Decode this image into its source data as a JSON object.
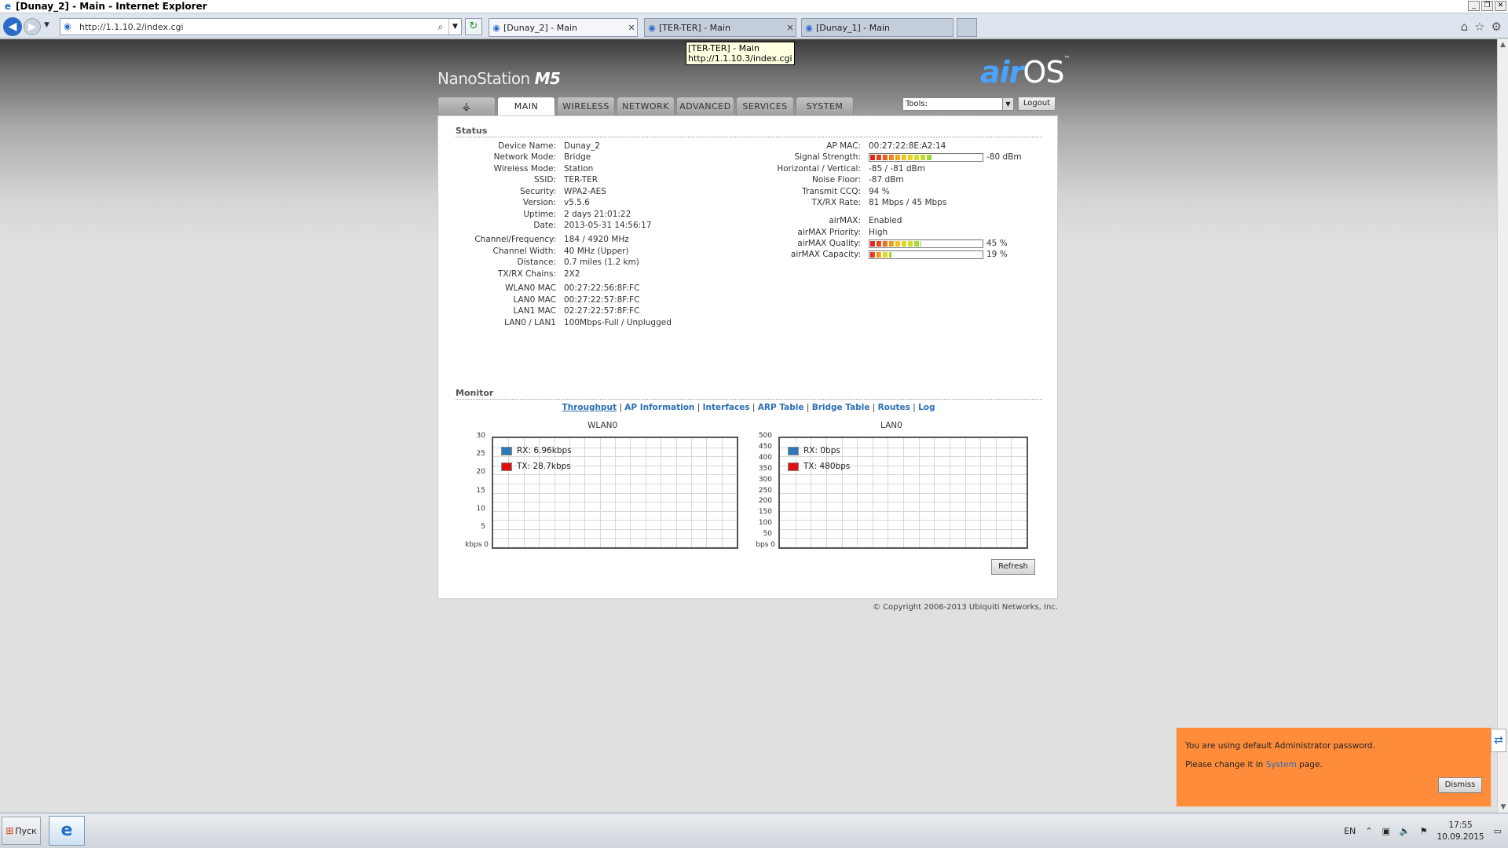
{
  "window": {
    "title": "[Dunay_2] - Main - Internet Explorer",
    "controls": [
      "_",
      "❐",
      "✕"
    ]
  },
  "browser": {
    "address": "http://1.1.10.2/index.cgi",
    "tabs": [
      {
        "label": "[Dunay_2] - Main",
        "active": true
      },
      {
        "label": "[TER-TER] - Main",
        "active": false
      },
      {
        "label": "[Dunay_1] - Main",
        "active": false
      }
    ],
    "tooltip": {
      "line1": "[TER-TER] - Main",
      "line2": "http://1.1.10.3/index.cgi"
    }
  },
  "device": {
    "product": "NanoStation",
    "model": "M5",
    "logo_air": "air",
    "logo_os": "OS",
    "logo_tm": "™"
  },
  "nav": {
    "tabs": [
      "MAIN",
      "WIRELESS",
      "NETWORK",
      "ADVANCED",
      "SERVICES",
      "SYSTEM"
    ],
    "active": "MAIN",
    "tools_label": "Tools:",
    "logout": "Logout"
  },
  "status": {
    "heading": "Status",
    "left": [
      {
        "k": "Device Name:",
        "v": "Dunay_2"
      },
      {
        "k": "Network Mode:",
        "v": "Bridge"
      },
      {
        "k": "Wireless Mode:",
        "v": "Station"
      },
      {
        "k": "SSID:",
        "v": "TER-TER"
      },
      {
        "k": "Security:",
        "v": "WPA2-AES"
      },
      {
        "k": "Version:",
        "v": "v5.5.6"
      },
      {
        "k": "Uptime:",
        "v": "2 days 21:01:22"
      },
      {
        "k": "Date:",
        "v": "2013-05-31 14:56:17"
      },
      {
        "k": "Channel/Frequency:",
        "v": "184 / 4920 MHz"
      },
      {
        "k": "Channel Width:",
        "v": "40 MHz (Upper)"
      },
      {
        "k": "Distance:",
        "v": "0.7 miles (1.2 km)"
      },
      {
        "k": "TX/RX Chains:",
        "v": "2X2"
      },
      {
        "k": "WLAN0 MAC",
        "v": "00:27:22:56:8F:FC"
      },
      {
        "k": "LAN0 MAC",
        "v": "00:27:22:57:8F:FC"
      },
      {
        "k": "LAN1 MAC",
        "v": "02:27:22:57:8F:FC"
      },
      {
        "k": "LAN0 / LAN1",
        "v": "100Mbps-Full / Unplugged"
      }
    ],
    "right": [
      {
        "k": "AP MAC:",
        "v": "00:27:22:8E:A2:14"
      },
      {
        "k": "Signal Strength:",
        "v": "-80 dBm",
        "bar": 0.55
      },
      {
        "k": "Horizontal / Vertical:",
        "v": "-85 / -81 dBm"
      },
      {
        "k": "Noise Floor:",
        "v": "-87 dBm"
      },
      {
        "k": "Transmit CCQ:",
        "v": "94 %"
      },
      {
        "k": "TX/RX Rate:",
        "v": "81 Mbps / 45 Mbps"
      },
      {
        "k": "airMAX:",
        "v": "Enabled"
      },
      {
        "k": "airMAX Priority:",
        "v": "High"
      },
      {
        "k": "airMAX Quality:",
        "v": "45 %",
        "bar": 0.45
      },
      {
        "k": "airMAX Capacity:",
        "v": "19 %",
        "bar": 0.19
      }
    ]
  },
  "monitor": {
    "heading": "Monitor",
    "links": [
      "Throughput",
      "AP Information",
      "Interfaces",
      "ARP Table",
      "Bridge Table",
      "Routes",
      "Log"
    ],
    "sep": "|",
    "refresh": "Refresh"
  },
  "chart_data": [
    {
      "type": "line",
      "title": "WLAN0",
      "yticks": [
        "30",
        "25",
        "20",
        "15",
        "10",
        "5",
        "kbps 0"
      ],
      "ylim": [
        0,
        30
      ],
      "series": [
        {
          "name": "RX: 6.96kbps",
          "color": "#2f78b8",
          "values": []
        },
        {
          "name": "TX: 28.7kbps",
          "color": "#e01010",
          "values": []
        }
      ]
    },
    {
      "type": "line",
      "title": "LAN0",
      "yticks": [
        "500",
        "450",
        "400",
        "350",
        "300",
        "250",
        "200",
        "150",
        "100",
        "50",
        "bps 0"
      ],
      "ylim": [
        0,
        500
      ],
      "series": [
        {
          "name": "RX: 0bps",
          "color": "#2f78b8",
          "values": []
        },
        {
          "name": "TX: 480bps",
          "color": "#e01010",
          "values": []
        }
      ]
    }
  ],
  "copyright": "© Copyright 2006-2013 Ubiquiti Networks, Inc.",
  "notice": {
    "line1": "You are using default Administrator password.",
    "pre": "Please change it in ",
    "link": "System",
    "post": " page.",
    "dismiss": "Dismiss"
  },
  "taskbar": {
    "start": "Пуск",
    "lang": "EN",
    "time": "17:55",
    "date": "10.09.2015"
  }
}
